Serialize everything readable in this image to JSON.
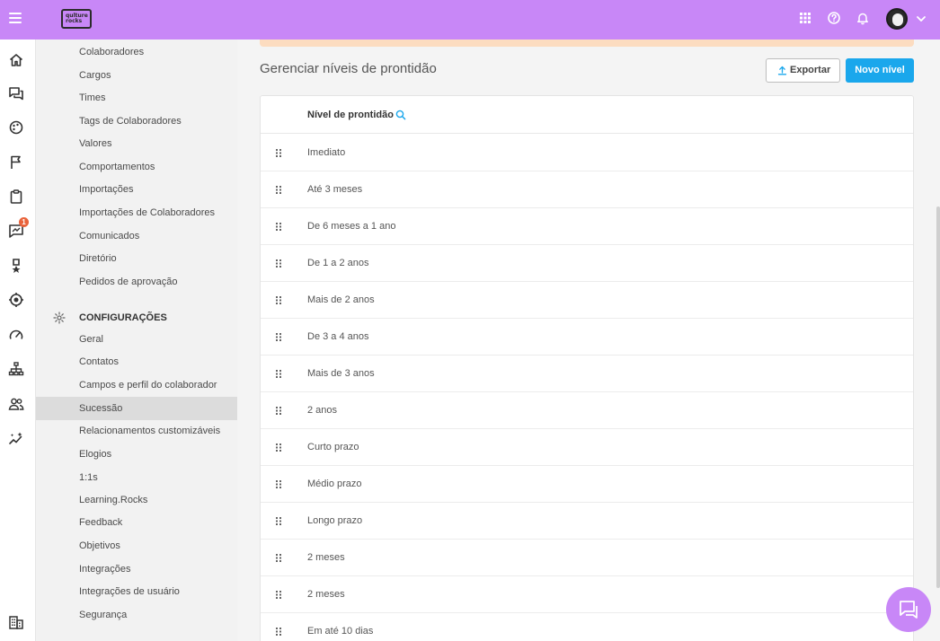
{
  "brand": {
    "logo_line1": "qulture",
    "logo_line2": "rocks",
    "accent": "#c887f7",
    "primary": "#1aa7ec"
  },
  "topbar": {
    "icons": [
      "menu-icon",
      "apps-grid-icon",
      "help-icon",
      "bell-icon",
      "avatar",
      "chevron-down-icon"
    ]
  },
  "rail": {
    "icons": [
      "home-icon",
      "chat-icon",
      "palette-icon",
      "flag-icon",
      "clipboard-icon",
      "feedback-icon",
      "medal-icon",
      "target-icon",
      "gauge-icon",
      "org-chart-icon",
      "people-icon",
      "sparkles-icon",
      "building-icon"
    ],
    "badge": "1"
  },
  "menu": {
    "items_top": [
      "Colaboradores",
      "Cargos",
      "Times",
      "Tags de Colaboradores",
      "Valores",
      "Comportamentos",
      "Importações",
      "Importações de Colaboradores",
      "Comunicados",
      "Diretório",
      "Pedidos de aprovação"
    ],
    "section_title": "CONFIGURAÇÕES",
    "items_config": [
      "Geral",
      "Contatos",
      "Campos e perfil do colaborador",
      "Sucessão",
      "Relacionamentos customizáveis",
      "Elogios",
      "1:1s",
      "Learning.Rocks",
      "Feedback",
      "Objetivos",
      "Integrações",
      "Integrações de usuário",
      "Segurança"
    ],
    "active": "Sucessão"
  },
  "main": {
    "title": "Gerenciar níveis de prontidão",
    "export_label": "Exportar",
    "new_label": "Novo nível"
  },
  "table": {
    "column_header": "Nível de prontidão",
    "rows": [
      "Imediato",
      "Até 3 meses",
      "De 6 meses a 1 ano",
      "De 1 a 2 anos",
      "Mais de 2 anos",
      "De 3 a 4 anos",
      "Mais de 3 anos",
      "2 anos",
      "Curto prazo",
      "Médio prazo",
      "Longo prazo",
      "2 meses",
      "2 meses",
      "Em até 10 dias"
    ]
  }
}
